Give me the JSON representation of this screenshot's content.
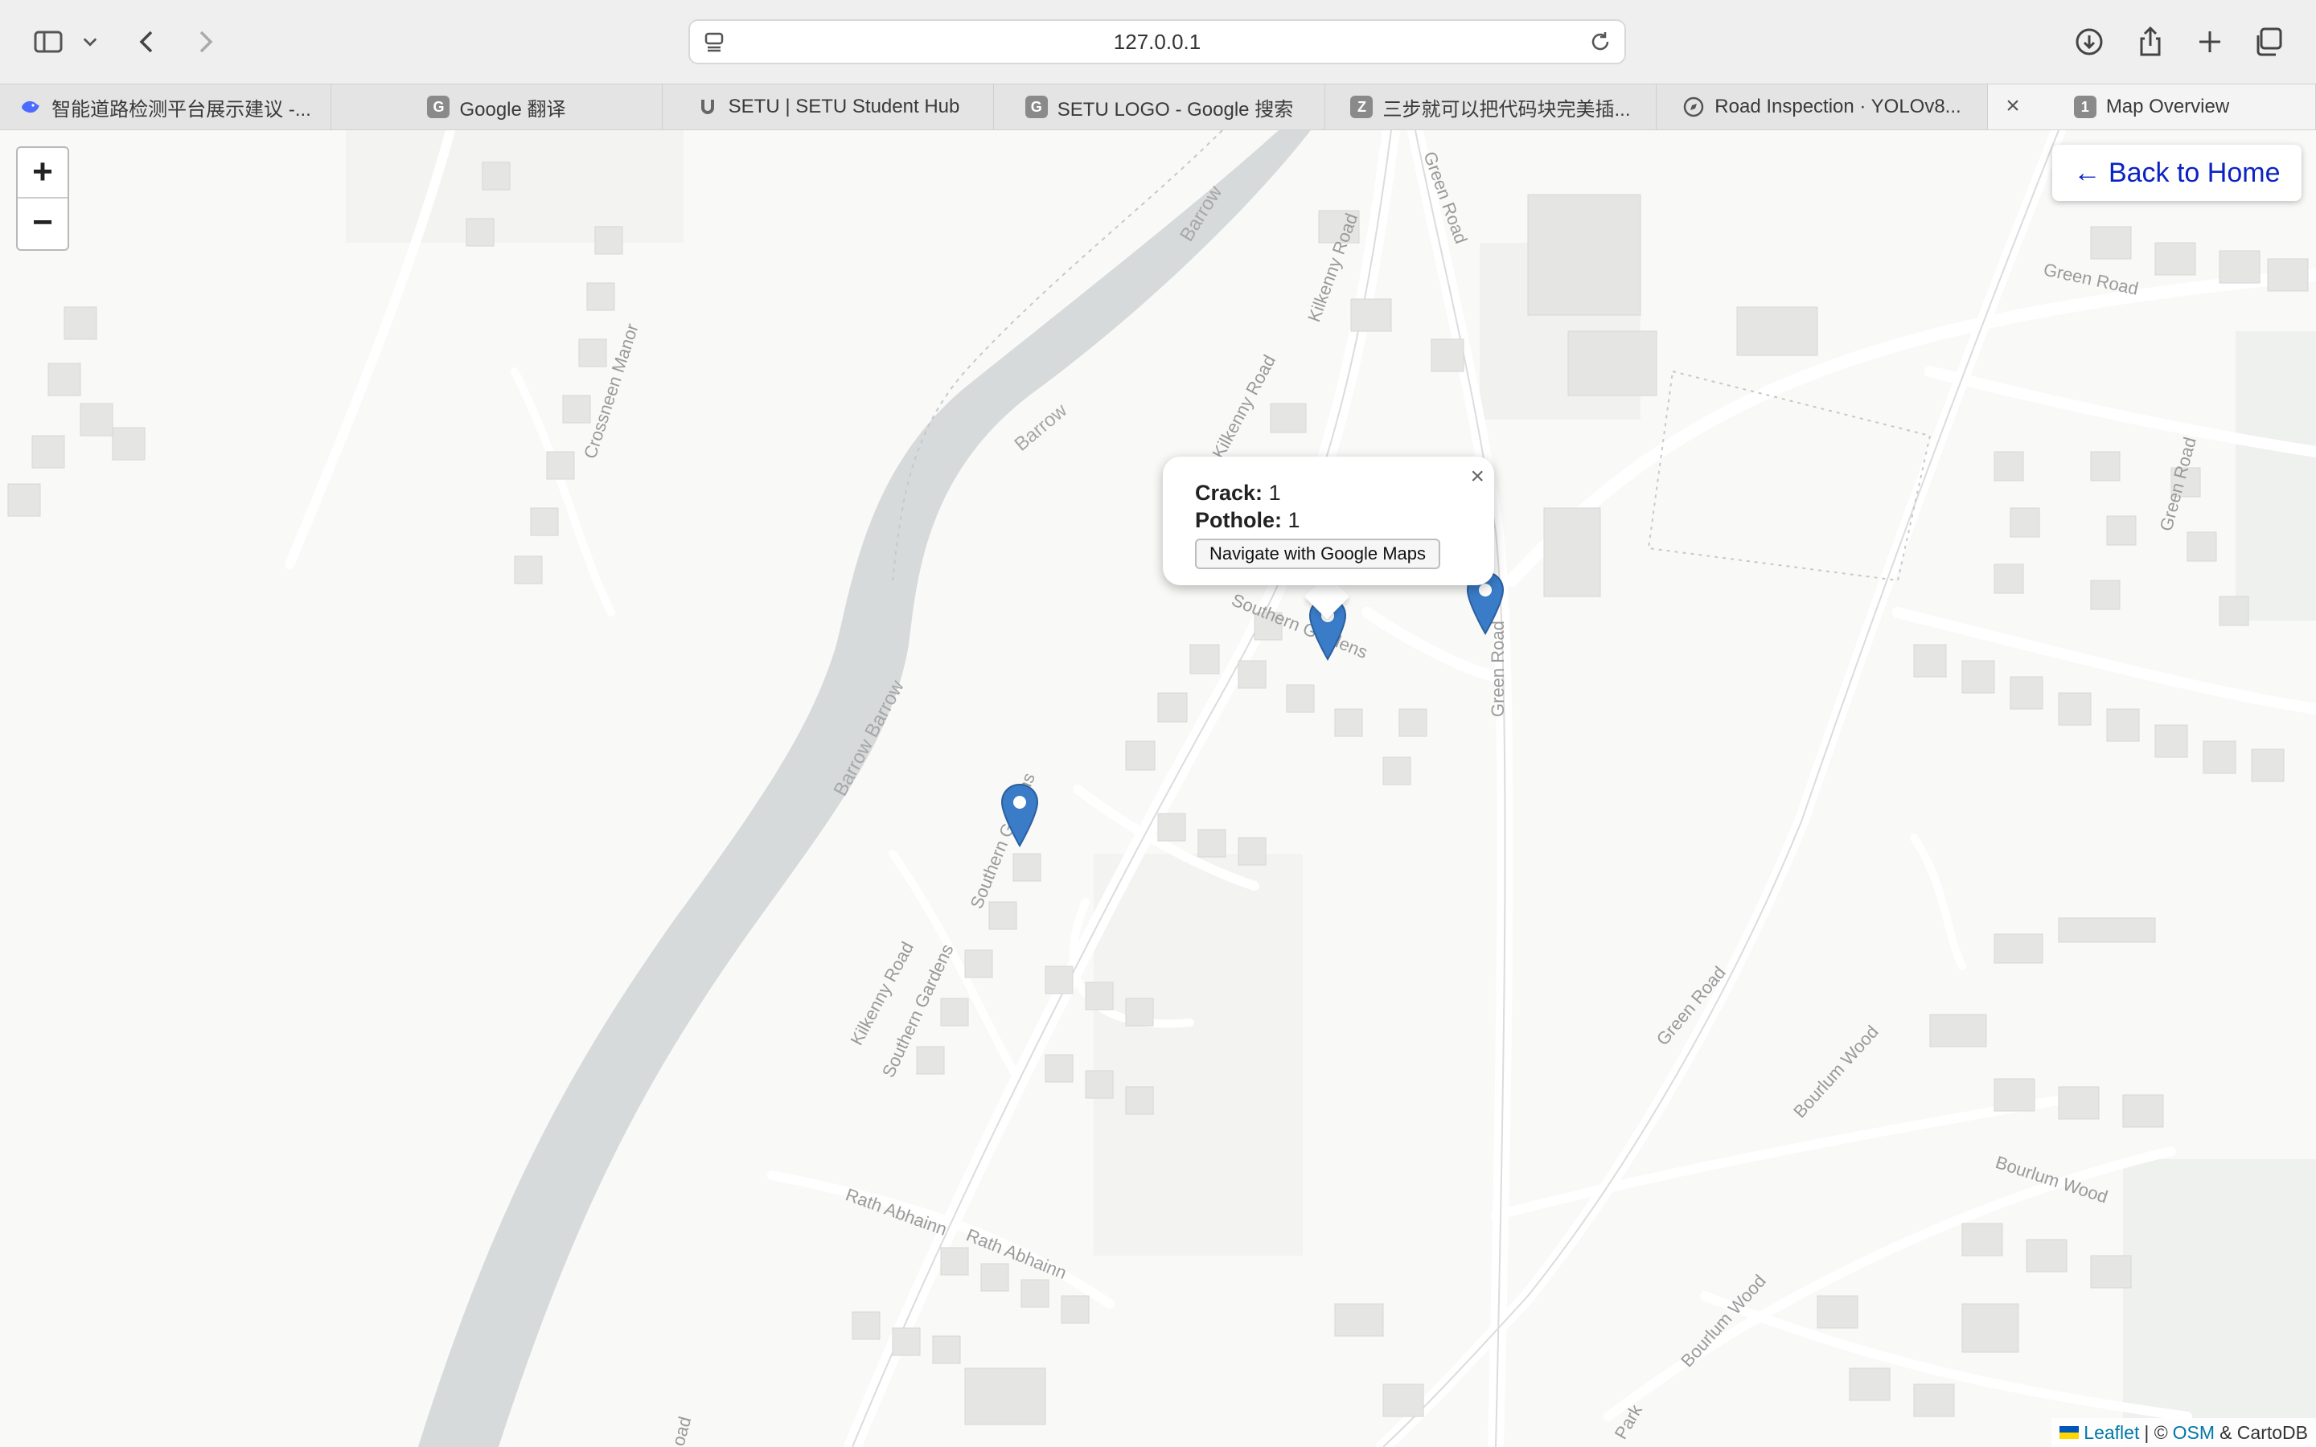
{
  "browser": {
    "address": "127.0.0.1",
    "icons": [
      "sidebar-icon",
      "chevron-down-icon",
      "back-icon",
      "forward-icon",
      "page-icon",
      "reload-icon",
      "download-icon",
      "share-icon",
      "new-tab-icon",
      "tab-overview-icon"
    ]
  },
  "tabs": [
    {
      "label": "智能道路检测平台展示建议 -...",
      "icon": "deepseek-icon",
      "icon_color": "#4d6bfe"
    },
    {
      "label": "Google 翻译",
      "icon_text": "G",
      "icon_color": "#8a8a8a"
    },
    {
      "label": "SETU | SETU Student Hub",
      "icon": "setu-icon",
      "icon_color": "#555555"
    },
    {
      "label": "SETU LOGO - Google 搜索",
      "icon_text": "G",
      "icon_color": "#8a8a8a"
    },
    {
      "label": "三步就可以把代码块完美插...",
      "icon_text": "Z",
      "icon_color": "#8a8a8a"
    },
    {
      "label": "Road Inspection · YOLOv8...",
      "icon": "compass-icon",
      "icon_color": "#555555"
    },
    {
      "label": "Map Overview",
      "icon_text": "1",
      "icon_color": "#8a8a8a",
      "active": true
    }
  ],
  "map": {
    "zoom_in": "+",
    "zoom_out": "−",
    "back_button": "← Back to Home",
    "street_labels": [
      "Barrow",
      "Barrow",
      "Barrow Barrow",
      "Crossneen Manor",
      "Kilkenny Road",
      "Kilkenny Road",
      "Kilkenny Road",
      "Green Road",
      "Green Road",
      "Green Road",
      "Green Road",
      "Green Road",
      "Southern Gardens",
      "Southern Gardens",
      "Southern Gardens",
      "Rath Abhainn",
      "Rath Abhainn",
      "Bourlum Wood",
      "Bourlum Wood",
      "Bourlum Wood",
      "Park",
      "oad"
    ],
    "popup": {
      "crack_label": "Crack:",
      "crack_value": "1",
      "pothole_label": "Pothole:",
      "pothole_value": "1",
      "navigate_label": "Navigate with Google Maps",
      "close": "×"
    },
    "marker_color": "#3a7cc7",
    "attribution": {
      "leaflet": "Leaflet",
      "separator": "| ©",
      "osm": "OSM",
      "rest": "& CartoDB"
    }
  }
}
